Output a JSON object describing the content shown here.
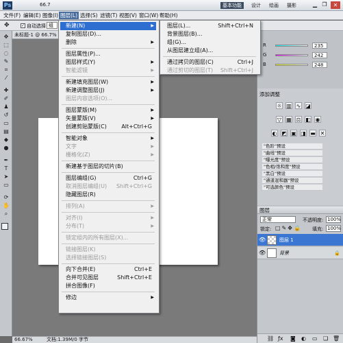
{
  "appbar": {
    "logo": "Ps",
    "zoom": "66.7",
    "essentials": "基本功能",
    "design": "设计",
    "painting": "绘画",
    "photography": "摄影"
  },
  "menubar": {
    "items": [
      "文件(F)",
      "编辑(E)",
      "图像(I)",
      "图层(L)",
      "选择(S)",
      "滤镜(T)",
      "视图(V)",
      "窗口(W)",
      "帮助(H)"
    ]
  },
  "options": {
    "autoselect": "自动选择：",
    "group": "组"
  },
  "document": {
    "tab": "未标题-1 @ 66.7% (图层1"
  },
  "status": {
    "zoom": "66.67%",
    "doc": "文档:1.39M/0 字节"
  },
  "layer_menu": [
    {
      "label": "新建(N)",
      "arrow": true,
      "hl": true
    },
    {
      "label": "复制图层(D)..."
    },
    {
      "label": "删除",
      "arrow": true
    },
    {
      "sep": true
    },
    {
      "label": "图层属性(P)..."
    },
    {
      "label": "图层样式(Y)",
      "arrow": true
    },
    {
      "label": "智能滤镜",
      "arrow": true,
      "dis": true
    },
    {
      "sep": true
    },
    {
      "label": "新建填充图层(W)",
      "arrow": true
    },
    {
      "label": "新建调整图层(J)",
      "arrow": true
    },
    {
      "label": "图层内容选项(O)...",
      "dis": true
    },
    {
      "sep": true
    },
    {
      "label": "图层蒙版(M)",
      "arrow": true
    },
    {
      "label": "矢量蒙版(V)",
      "arrow": true
    },
    {
      "label": "创建剪贴蒙版(C)",
      "sc": "Alt+Ctrl+G"
    },
    {
      "sep": true
    },
    {
      "label": "智能对象",
      "arrow": true
    },
    {
      "label": "文字",
      "arrow": true,
      "dis": true
    },
    {
      "label": "栅格化(Z)",
      "arrow": true,
      "dis": true
    },
    {
      "sep": true
    },
    {
      "label": "新建基于图层的切片(B)"
    },
    {
      "sep": true
    },
    {
      "label": "图层编组(G)",
      "sc": "Ctrl+G"
    },
    {
      "label": "取消图层编组(U)",
      "sc": "Shift+Ctrl+G",
      "dis": true
    },
    {
      "label": "隐藏图层(R)"
    },
    {
      "sep": true
    },
    {
      "label": "排列(A)",
      "arrow": true,
      "dis": true
    },
    {
      "sep": true
    },
    {
      "label": "对齐(I)",
      "arrow": true,
      "dis": true
    },
    {
      "label": "分布(T)",
      "arrow": true,
      "dis": true
    },
    {
      "sep": true
    },
    {
      "label": "锁定组内的所有图层(X)...",
      "dis": true
    },
    {
      "sep": true
    },
    {
      "label": "链接图层(K)",
      "dis": true
    },
    {
      "label": "选择链接图层(S)",
      "dis": true
    },
    {
      "sep": true
    },
    {
      "label": "向下合并(E)",
      "sc": "Ctrl+E"
    },
    {
      "label": "合并可见图层",
      "sc": "Shift+Ctrl+E"
    },
    {
      "label": "拼合图像(F)"
    },
    {
      "sep": true
    },
    {
      "label": "修边",
      "arrow": true
    }
  ],
  "new_submenu": [
    {
      "label": "图层(L)...",
      "sc": "Shift+Ctrl+N"
    },
    {
      "label": "背景图层(B)..."
    },
    {
      "label": "组(G)..."
    },
    {
      "label": "从图层建立组(A)..."
    },
    {
      "sep": true
    },
    {
      "label": "通过拷贝的图层(C)",
      "sc": "Ctrl+J"
    },
    {
      "label": "通过剪切的图层(T)",
      "sc": "Shift+Ctrl+J",
      "dis": true
    }
  ],
  "color_panel": {
    "labels": [
      "R",
      "G",
      "B"
    ],
    "values": [
      "235",
      "242",
      "248"
    ]
  },
  "adjust_panel": {
    "title": "添加调整"
  },
  "presets": [
    "\"色阶\"预设",
    "\"曲线\"预设",
    "\"曝光度\"预设",
    "\"色相/饱和度\"预设",
    "\"黑白\"预设",
    "\"通道混和器\"预设",
    "\"可选颜色\"预设"
  ],
  "layers_panel": {
    "tab": "图层",
    "blend": "正常",
    "opacity_label": "不透明度:",
    "opacity": "100%",
    "lock_label": "锁定:",
    "fill_label": "填充:",
    "fill": "100%",
    "layers": [
      {
        "name": "图层 1",
        "selected": true
      },
      {
        "name": "背景",
        "italic": true
      }
    ]
  },
  "colors": {
    "accent": "#2e6ed1",
    "menu_hl": "#4a6f9f"
  }
}
